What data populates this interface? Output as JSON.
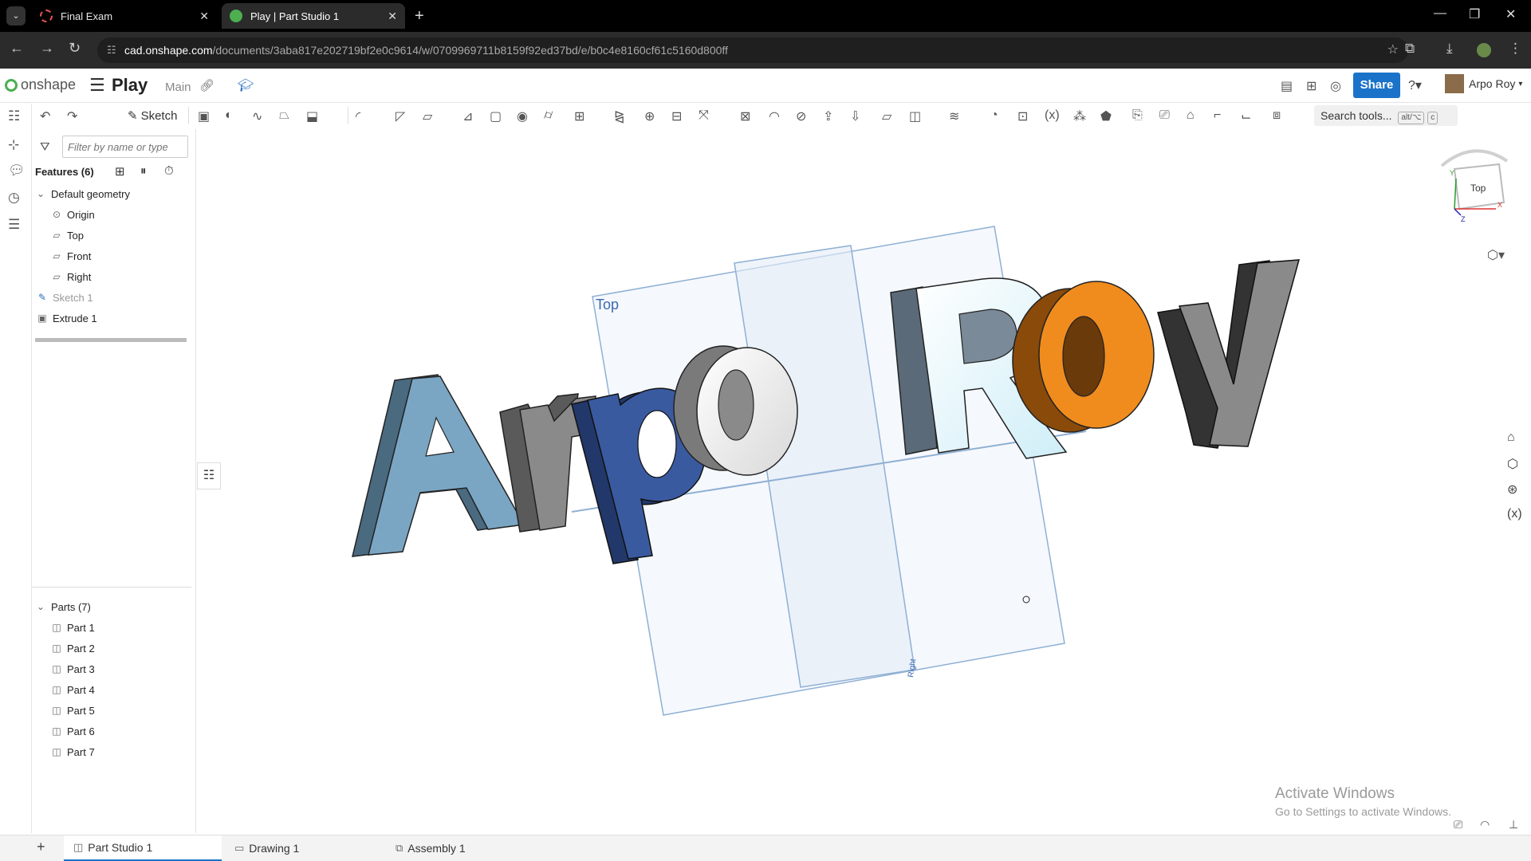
{
  "browser": {
    "tabs": [
      {
        "title": "Final Exam",
        "active": false
      },
      {
        "title": "Play | Part Studio 1",
        "active": true
      }
    ],
    "url_host": "cad.onshape.com",
    "url_path": "/documents/3aba817e202719bf2e0c9614/w/0709969711b8159f92ed37bd/e/b0c4e8160cf61c5160d800ff"
  },
  "header": {
    "logo_text": "onshape",
    "doc_title": "Play",
    "branch": "Main",
    "share_label": "Share",
    "user_name": "Arpo Roy"
  },
  "toolbar": {
    "sketch_label": "Sketch",
    "search_label": "Search tools...",
    "search_shortcut_1": "alt/⌥",
    "search_shortcut_2": "c"
  },
  "features": {
    "filter_placeholder": "Filter by name or type",
    "header": "Features (6)",
    "default_geometry_label": "Default geometry",
    "items": [
      "Origin",
      "Top",
      "Front",
      "Right"
    ],
    "sketch": "Sketch 1",
    "extrude": "Extrude 1"
  },
  "parts": {
    "header": "Parts (7)",
    "items": [
      "Part 1",
      "Part 2",
      "Part 3",
      "Part 4",
      "Part 5",
      "Part 6",
      "Part 7"
    ]
  },
  "bottom_tabs": [
    "Part Studio 1",
    "Drawing 1",
    "Assembly 1"
  ],
  "viewport": {
    "plane_label": "Top",
    "plane_label_2": "Right",
    "view_cube_label": "Top",
    "axis_x": "X",
    "axis_y": "Y",
    "axis_z": "Z",
    "text_3d": "ArpoRoy"
  },
  "watermark": {
    "line1": "Activate Windows",
    "line2": "Go to Settings to activate Windows."
  },
  "colors": {
    "share_blue": "#1a73c8",
    "letter_A": "#7aa6c4",
    "letter_r": "#808080",
    "letter_p": "#3a5aa0",
    "letter_o": "#f0f0f0",
    "letter_R": "#e6f4fb",
    "letter_o2": "#f08c1e",
    "letter_y": "#707070"
  }
}
